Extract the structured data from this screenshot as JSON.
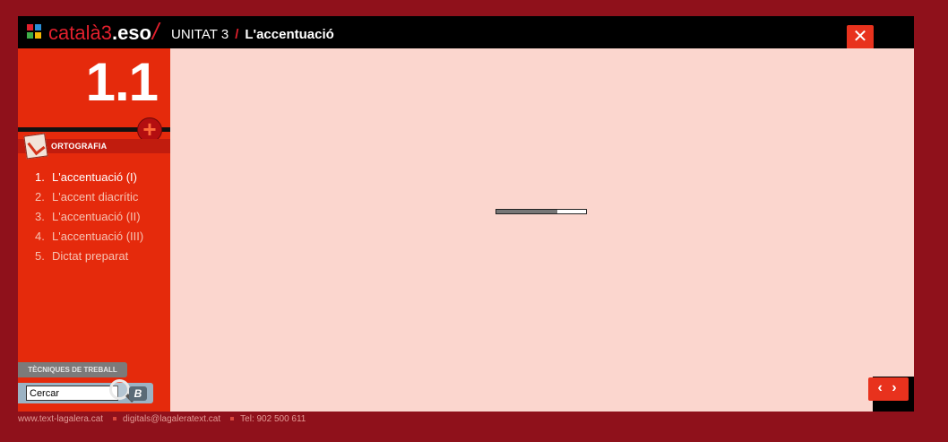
{
  "header": {
    "brand_main": "català3",
    "brand_suffix": ".eso",
    "brand_slash": "/",
    "unit": "UNITAT 3",
    "separator": "/",
    "topic": "L'accentuació",
    "close_label": "✕"
  },
  "logo_colors": [
    "#e2202d",
    "#2a8fd6",
    "#3fae49",
    "#f2b705"
  ],
  "sidebar": {
    "section_number": "1.1",
    "plus_label": "+",
    "category": "ORTOGRAFIA",
    "lessons": [
      {
        "num": "1.",
        "label": "L'accentuació (I)"
      },
      {
        "num": "2.",
        "label": "L'accent diacrític"
      },
      {
        "num": "3.",
        "label": "L'accentuació (II)"
      },
      {
        "num": "4.",
        "label": "L'accentuació (III)"
      },
      {
        "num": "5.",
        "label": "Dictat preparat"
      }
    ],
    "tools_tab": "TÈCNIQUES DE TREBALL",
    "search": {
      "value": "Cercar",
      "button_label": "B"
    }
  },
  "content": {
    "loading_progress": 0.68
  },
  "nav": {
    "arrows_label": "‹ ›"
  },
  "footer": {
    "website": "www.text-lagalera.cat",
    "email": "digitals@lagaleratext.cat",
    "phone": "Tel: 902 500 611"
  },
  "colors": {
    "frame": "#8f111b",
    "accent": "#e52a0c",
    "content_bg": "#fbd6ce",
    "header_bg": "#000000"
  }
}
